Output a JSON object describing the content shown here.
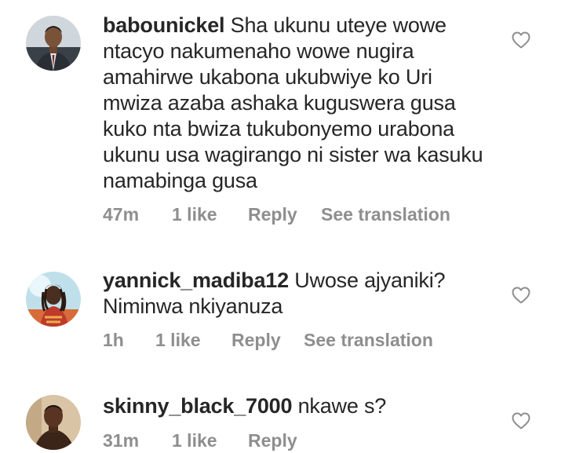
{
  "comments": [
    {
      "username": "babounickel",
      "text": "Sha ukunu uteye wowe ntacyo nakumenaho wowe nugira amahirwe ukabona ukubwiye ko Uri mwiza azaba ashaka kuguswera gusa kuko nta bwiza tukubonyemo urabona ukunu usa wagirango ni sister wa kasuku namabinga gusa",
      "time": "47m",
      "likes": "1 like",
      "reply_label": "Reply",
      "translate_label": "See translation",
      "avatar_icon": "avatar-person-suit"
    },
    {
      "username": "yannick_madiba12",
      "text": "Uwose ajyaniki? Niminwa nkiyanuza",
      "time": "1h",
      "likes": "1 like",
      "reply_label": "Reply",
      "translate_label": "See translation",
      "avatar_icon": "avatar-person-dreadlocks"
    },
    {
      "username": "skinny_black_7000",
      "text": "nkawe s?",
      "time": "31m",
      "likes": "1 like",
      "reply_label": "Reply",
      "avatar_icon": "avatar-person-portrait"
    }
  ],
  "icons": {
    "like": "heart-outline-icon"
  },
  "colors": {
    "text": "#262626",
    "meta": "#8e8e8e",
    "heart": "#8e8e8e"
  }
}
